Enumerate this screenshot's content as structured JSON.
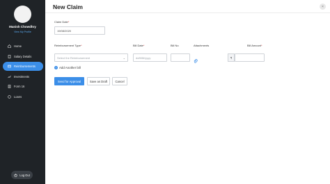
{
  "sidebar": {
    "user_name": "Manish Chowdhry",
    "view_profile": "View My Profile",
    "items": [
      {
        "label": "Home",
        "icon": "home-icon"
      },
      {
        "label": "Salary Details",
        "icon": "document-icon"
      },
      {
        "label": "Reimbursements",
        "icon": "reimbursement-icon",
        "active": true
      },
      {
        "label": "Investments",
        "icon": "investments-icon"
      },
      {
        "label": "Form 16",
        "icon": "form-icon"
      },
      {
        "label": "Loans",
        "icon": "loans-icon"
      }
    ],
    "logout": "Log Out"
  },
  "header": {
    "title": "New Claim",
    "close_icon": "×"
  },
  "form": {
    "claim_date_label": "Claim Date",
    "claim_date_value": "19/08/2020",
    "required_mark": "*",
    "columns": {
      "reimbursement_type": "Reimbursement Type",
      "bill_date": "Bill Date",
      "bill_no": "Bill No",
      "attachments": "Attachments",
      "bill_amount": "Bill Amount"
    },
    "reimbursement_placeholder": "Select the Reimbursement",
    "bill_date_placeholder": "dd/MM/yyyy",
    "currency_symbol": "₹",
    "add_another": "Add Another bill"
  },
  "actions": {
    "send_for_approval": "Send for Approval",
    "save_as_draft": "Save as Draft",
    "cancel": "Cancel"
  },
  "colors": {
    "sidebar_bg": "#1f2327",
    "accent": "#3b8ee8",
    "required": "#e03131"
  }
}
